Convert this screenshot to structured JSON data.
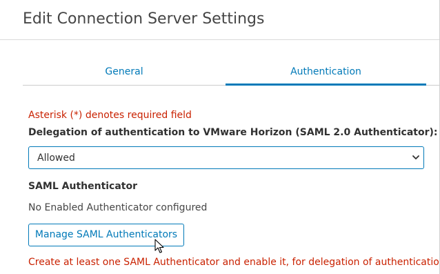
{
  "dialog": {
    "title": "Edit Connection Server Settings"
  },
  "tabs": [
    {
      "label": "General",
      "active": false
    },
    {
      "label": "Authentication",
      "active": true
    }
  ],
  "form": {
    "required_note": "Asterisk (*) denotes required field",
    "delegation_label": "Delegation of authentication to VMware Horizon (SAML 2.0 Authenticator):",
    "delegation_value": "Allowed",
    "saml_section_label": "SAML Authenticator",
    "saml_status": "No Enabled Authenticator configured",
    "manage_button_label": "Manage SAML Authenticators",
    "warning": "Create at least one SAML Authenticator and enable it, for delegation of authentication to SAML"
  },
  "colors": {
    "accent": "#0079b8",
    "error": "#c92100",
    "text": "#313131"
  },
  "icons": {
    "select_chevron": "chevron-down-icon",
    "mouse_cursor": "mouse-pointer-icon"
  }
}
